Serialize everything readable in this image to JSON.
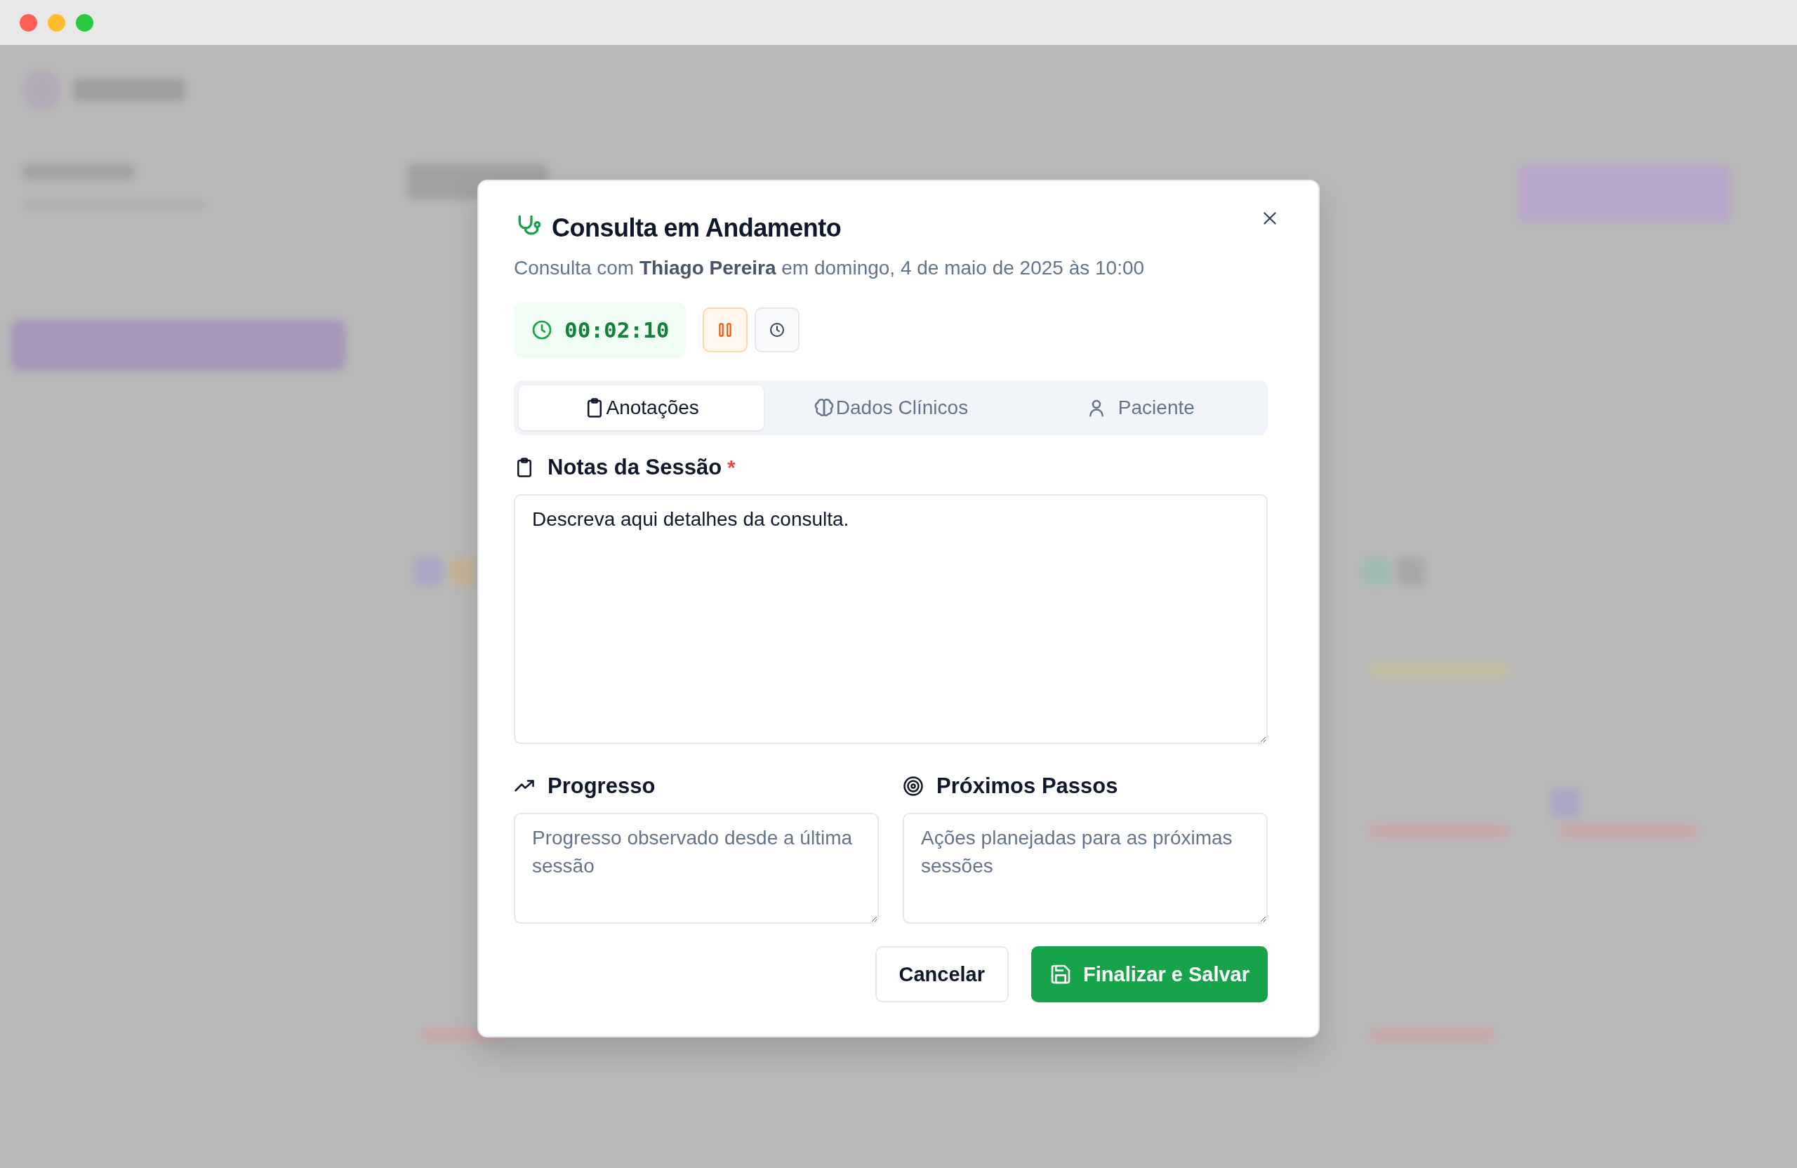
{
  "dialog": {
    "title": "Consulta em Andamento",
    "subtitle": "Consulta com **Thiago Pereira** em domingo, 4 de maio de 2025 às 10:00",
    "timer": {
      "value": "00:02:10",
      "running": true
    },
    "tabs": [
      {
        "label": "Anotações",
        "selected": true
      },
      {
        "label": "Dados Clínicos",
        "selected": false
      },
      {
        "label": "Paciente",
        "selected": false
      }
    ],
    "notes": {
      "label": "Notas da Sessão",
      "required": true,
      "required_mark": "*",
      "value": "Descreva aqui detalhes da consulta."
    },
    "progress": {
      "label": "Progresso",
      "placeholder": "Progresso observado desde a última sessão"
    },
    "next_steps": {
      "label": "Próximos Passos",
      "placeholder": "Ações planejadas para as próximas sessões"
    },
    "buttons": {
      "cancel": "Cancelar",
      "save": "Finalizar e Salvar"
    }
  }
}
